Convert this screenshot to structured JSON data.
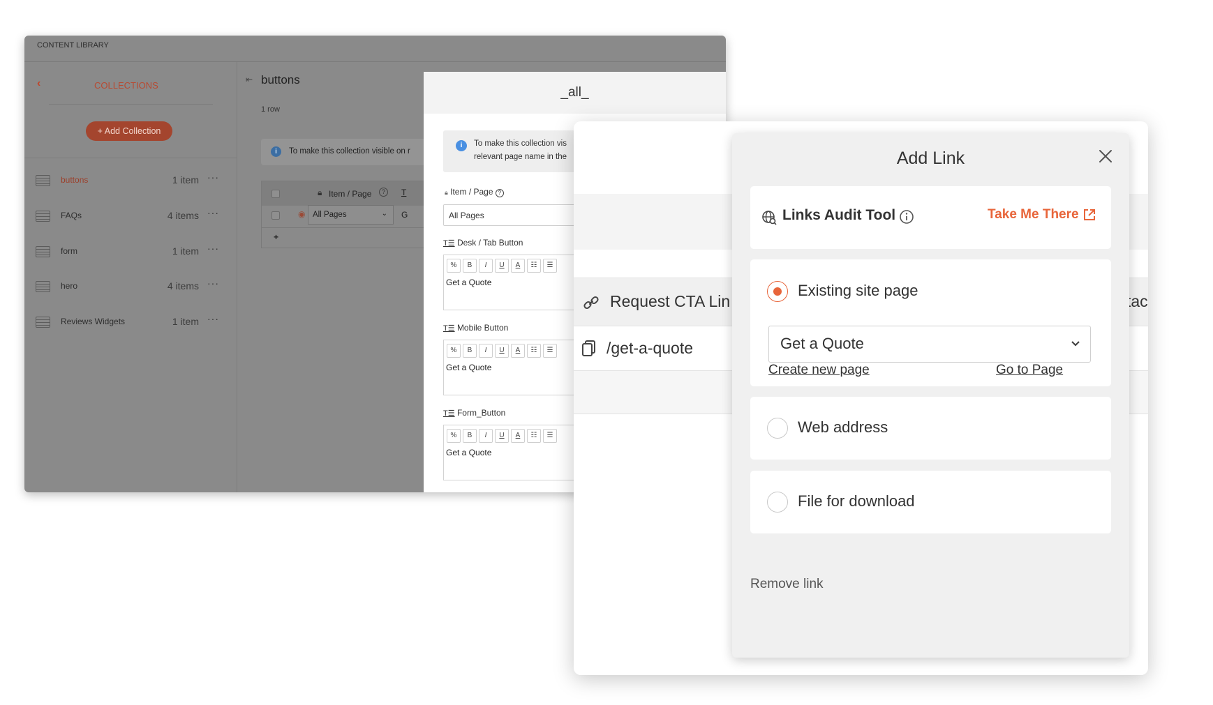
{
  "library": {
    "window_title": "CONTENT LIBRARY",
    "sidebar": {
      "title": "COLLECTIONS",
      "add_button": "+ Add Collection",
      "collections": [
        {
          "name": "buttons",
          "count": "1 item",
          "active": true
        },
        {
          "name": "FAQs",
          "count": "4 items",
          "active": false
        },
        {
          "name": "form",
          "count": "1 item",
          "active": false
        },
        {
          "name": "hero",
          "count": "4 items",
          "active": false
        },
        {
          "name": "Reviews Widgets",
          "count": "1 item",
          "active": false
        }
      ]
    },
    "main": {
      "title": "buttons",
      "row_count": "1 row",
      "info_text": "To make this collection visible on r",
      "grid_header": "Item / Page",
      "grid_header_extra": "T",
      "grid_row_value": "All Pages",
      "grid_row_extra": "G",
      "add_row": "+"
    }
  },
  "all_panel": {
    "title": "_all_",
    "info_line1": "To make this collection vis",
    "info_line2": "relevant page name in the",
    "item_page_label": "Item / Page",
    "item_page_value": "All Pages",
    "fields": [
      {
        "label": "Desk / Tab Button",
        "value": "Get a Quote"
      },
      {
        "label": "Mobile Button",
        "value": "Get a Quote"
      },
      {
        "label": "Form_Button",
        "value": "Get a Quote"
      }
    ],
    "toolbar": [
      "%",
      "B",
      "I",
      "U",
      "A",
      "☷",
      "☰"
    ]
  },
  "link_dialog": {
    "cta_label": "Request CTA Lin",
    "cta_suffix": "tac",
    "url_value": "/get-a-quote"
  },
  "add_link": {
    "title": "Add Link",
    "audit_tool": "Links Audit Tool",
    "take_me_there": "Take Me There",
    "options": [
      {
        "label": "Existing site page",
        "selected": true
      },
      {
        "label": "Web address",
        "selected": false
      },
      {
        "label": "File for download",
        "selected": false
      }
    ],
    "selected_page": "Get a Quote",
    "create_new_page": "Create new page",
    "go_to_page": "Go to Page",
    "remove_link": "Remove link"
  },
  "colors": {
    "accent": "#e8653a",
    "info_blue": "#4a90e2"
  }
}
